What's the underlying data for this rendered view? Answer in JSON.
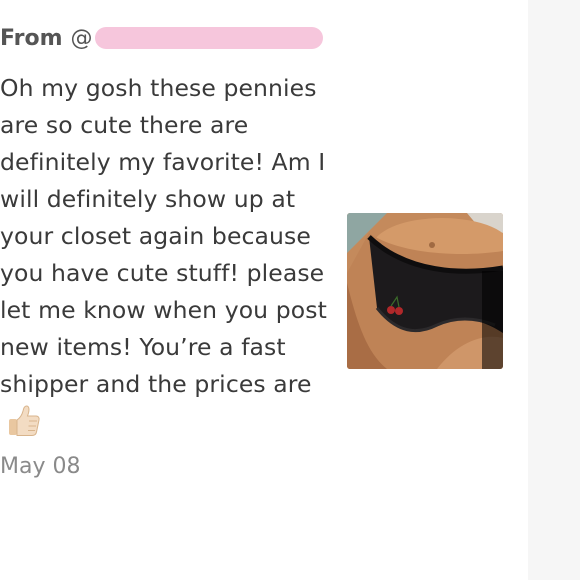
{
  "review": {
    "from_label": "From",
    "at_sign": "@",
    "text": "Oh my gosh these pennies are so cute there are definitely my favorite! Am I will definitely show up at your closet again because you have cute stuff! please let me know when you post new items! You’re a fast shipper and the prices are",
    "trailing_emoji": "thumbs-up-icon",
    "date": "May 08"
  },
  "photo": {
    "kind": "listing-photo"
  },
  "colors": {
    "redaction": "#f6c6dc",
    "text": "#3a3a3a",
    "date": "#8a8a8a"
  }
}
